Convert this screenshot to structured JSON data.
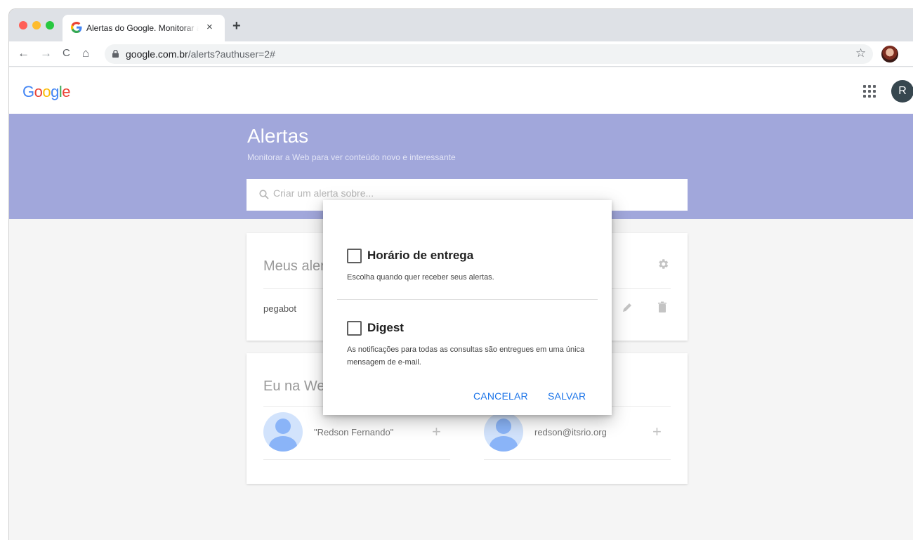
{
  "browser": {
    "tab_title": "Alertas do Google. Monitorar a Web para ver conteúdo novo e interessante",
    "tab_close": "×",
    "new_tab": "+",
    "url_host": "google.com.br",
    "url_path": "/alerts?authuser=2#",
    "back": "←",
    "forward": "→",
    "reload": "C",
    "home": "⌂",
    "star": "☆",
    "menu": "⋮"
  },
  "appbar": {
    "logo": [
      "G",
      "o",
      "o",
      "g",
      "l",
      "e"
    ],
    "logo_colors": [
      "#4285f4",
      "#ea4335",
      "#fbbc05",
      "#4285f4",
      "#34a853",
      "#ea4335"
    ],
    "avatar_letter": "R"
  },
  "hero": {
    "title": "Alertas",
    "subtitle": "Monitorar a Web para ver conteúdo novo e interessante",
    "search_placeholder": "Criar um alerta sobre..."
  },
  "my_alerts": {
    "title": "Meus alertas",
    "items": [
      {
        "name": "pegabot"
      }
    ]
  },
  "me_on_web": {
    "title": "Eu na Web",
    "people": [
      {
        "name": "\"Redson Fernando\"",
        "plus": "+"
      },
      {
        "name": "redson@itsrio.org",
        "plus": "+"
      }
    ]
  },
  "dialog": {
    "delivery_title": "Horário de entrega",
    "delivery_desc": "Escolha quando quer receber seus alertas.",
    "digest_title": "Digest",
    "digest_desc": "As notificações para todas as consultas são entregues em uma única mensagem de e-mail.",
    "cancel": "CANCELAR",
    "save": "SALVAR"
  },
  "colors": {
    "hero": "#a1a7db",
    "accent": "#1a73e8"
  }
}
